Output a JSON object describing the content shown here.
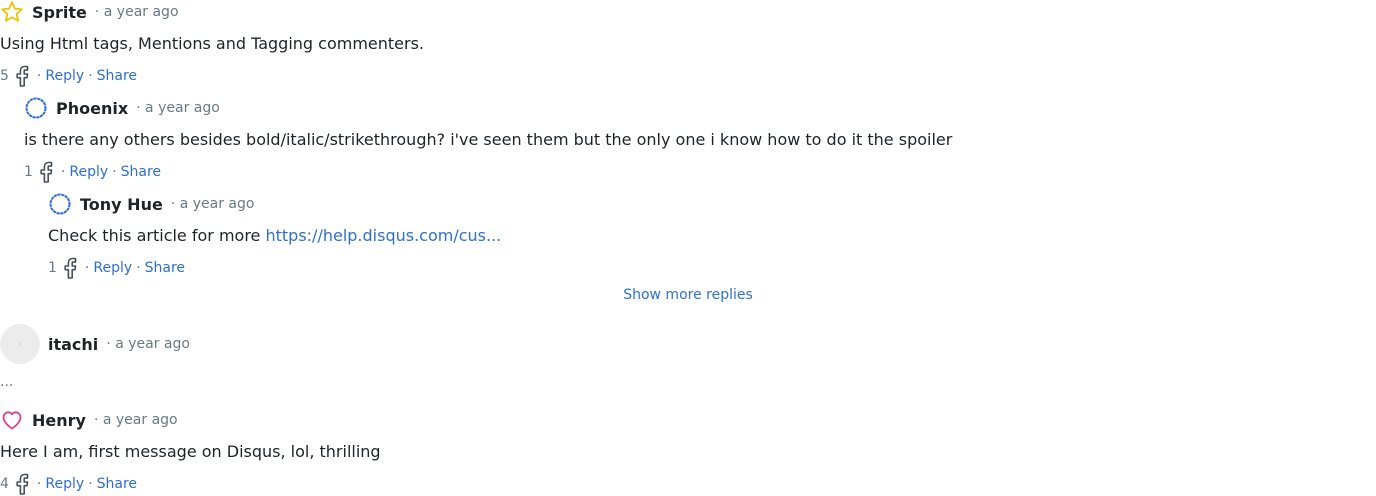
{
  "comments": [
    {
      "author": "Sprite",
      "time": "· a year ago",
      "badge_icon": "star-icon",
      "badge_color": "#f2c200",
      "text": "Using Html tags, Mentions and Tagging commenters.",
      "likes": "5",
      "reply_label": "Reply",
      "share_label": "Share"
    },
    {
      "author": "Phoenix",
      "time": "· a year ago",
      "badge_icon": "moderator-badge-icon",
      "badge_color": "#2e6fd0",
      "text": "is there any others besides bold/italic/strikethrough? i've seen them but the only one i know how to do it the spoiler",
      "likes": "1",
      "reply_label": "Reply",
      "share_label": "Share"
    },
    {
      "author": "Tony Hue",
      "time": "· a year ago",
      "badge_icon": "moderator-badge-icon",
      "badge_color": "#2e6fd0",
      "text": "Check this article for more ",
      "link_text": "https://help.disqus.com/cus...",
      "likes": "1",
      "reply_label": "Reply",
      "share_label": "Share"
    },
    {
      "author": "itachi",
      "time": "· a year ago",
      "badge_icon": "avatar-placeholder",
      "text": "..."
    },
    {
      "author": "Henry",
      "time": "· a year ago",
      "badge_icon": "heart-icon",
      "badge_color": "#e0428a",
      "text": "Here I am, first message on Disqus, lol, thrilling",
      "likes": "4",
      "reply_label": "Reply",
      "share_label": "Share"
    }
  ],
  "show_more_label": "Show more replies",
  "separator": "·",
  "like_icon": "facebook-icon"
}
